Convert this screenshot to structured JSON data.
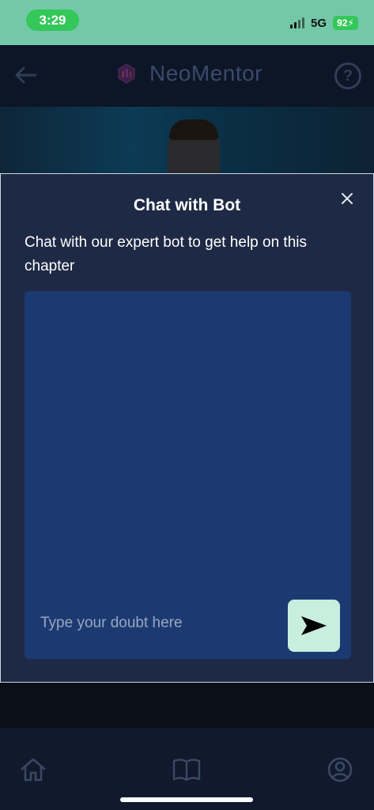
{
  "status_bar": {
    "time": "3:29",
    "network": "5G",
    "battery": "92"
  },
  "header": {
    "title": "NeoMentor",
    "help_symbol": "?",
    "back_icon": "arrow-left-icon",
    "logo_icon": "neomentor-logo-icon"
  },
  "modal": {
    "title": "Chat with Bot",
    "subtitle": "Chat with our expert bot to get help on this chapter",
    "input_placeholder": "Type your doubt here",
    "input_value": "",
    "send_icon": "send-arrow-icon",
    "close_icon": "close-icon"
  },
  "bottom_nav": {
    "items": [
      {
        "icon": "home-icon"
      },
      {
        "icon": "book-icon"
      },
      {
        "icon": "user-circle-icon"
      }
    ]
  },
  "colors": {
    "status_bar": "#74c8a9",
    "modal_bg": "#1e2a45",
    "chat_panel": "#1c3a72",
    "send_button": "#c8eedf",
    "time_pill": "#34c759"
  }
}
